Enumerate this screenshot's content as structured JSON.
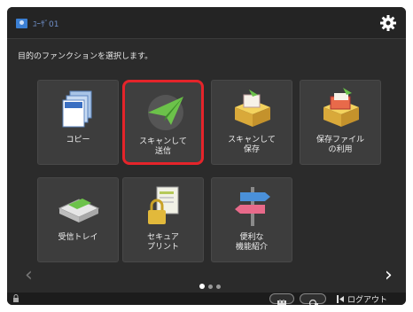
{
  "header": {
    "user_name": "ﾕｰｻﾞ01",
    "settings_icon": "gear-icon"
  },
  "subtitle": "目的のファンクションを選択します。",
  "tiles": [
    {
      "label": "コピー",
      "icon": "copy-icon"
    },
    {
      "label": "スキャンして\n送信",
      "icon": "scan-send-icon",
      "selected": true
    },
    {
      "label": "スキャンして\n保存",
      "icon": "scan-store-icon"
    },
    {
      "label": "保存ファイル\nの利用",
      "icon": "stored-files-icon"
    },
    {
      "label": "受信トレイ",
      "icon": "inbox-icon"
    },
    {
      "label": "セキュア\nプリント",
      "icon": "secure-print-icon"
    },
    {
      "label": "便利な\n機能紹介",
      "icon": "useful-features-icon"
    }
  ],
  "pager": {
    "pages": 3,
    "current": 1
  },
  "footer": {
    "logout_label": "ログアウト"
  },
  "colors": {
    "selection": "#e5242a",
    "background": "#2b2b2b",
    "tile": "#3d3d3d"
  }
}
